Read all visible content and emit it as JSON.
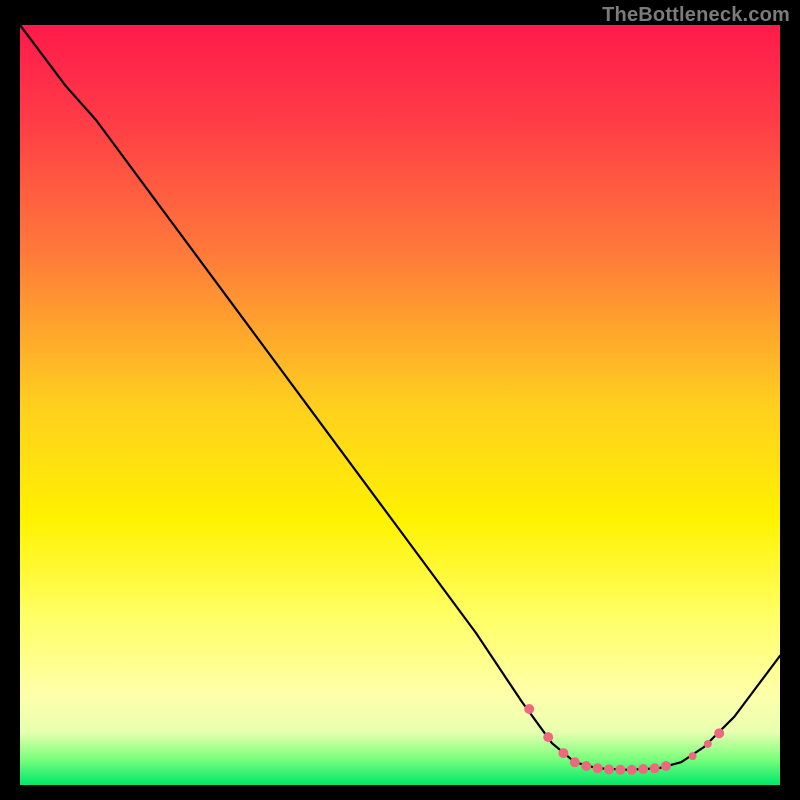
{
  "attribution": "TheBottleneck.com",
  "chart_data": {
    "type": "line",
    "title": "",
    "xlabel": "",
    "ylabel": "",
    "xlim": [
      0,
      100
    ],
    "ylim": [
      0,
      100
    ],
    "grid": false,
    "gradient_stops": [
      {
        "offset": 0.0,
        "color": "#ff1a4b"
      },
      {
        "offset": 0.12,
        "color": "#ff3a47"
      },
      {
        "offset": 0.3,
        "color": "#ff7a3a"
      },
      {
        "offset": 0.5,
        "color": "#ffcf1f"
      },
      {
        "offset": 0.65,
        "color": "#fff200"
      },
      {
        "offset": 0.78,
        "color": "#ffff66"
      },
      {
        "offset": 0.88,
        "color": "#ffffaa"
      },
      {
        "offset": 0.93,
        "color": "#e8ffb0"
      },
      {
        "offset": 0.965,
        "color": "#7dff7d"
      },
      {
        "offset": 1.0,
        "color": "#00e86a"
      }
    ],
    "curve": [
      {
        "x": 0.0,
        "y": 100.0
      },
      {
        "x": 6.0,
        "y": 92.0
      },
      {
        "x": 10.0,
        "y": 87.5
      },
      {
        "x": 20.0,
        "y": 74.0
      },
      {
        "x": 30.0,
        "y": 60.5
      },
      {
        "x": 40.0,
        "y": 47.0
      },
      {
        "x": 50.0,
        "y": 33.5
      },
      {
        "x": 60.0,
        "y": 20.0
      },
      {
        "x": 66.0,
        "y": 11.0
      },
      {
        "x": 70.0,
        "y": 5.5
      },
      {
        "x": 73.0,
        "y": 3.0
      },
      {
        "x": 76.0,
        "y": 2.2
      },
      {
        "x": 80.0,
        "y": 2.0
      },
      {
        "x": 84.0,
        "y": 2.2
      },
      {
        "x": 87.0,
        "y": 3.0
      },
      {
        "x": 90.0,
        "y": 5.0
      },
      {
        "x": 94.0,
        "y": 9.0
      },
      {
        "x": 100.0,
        "y": 17.0
      }
    ],
    "markers": [
      {
        "x": 67.0,
        "y": 10.0,
        "r": 5
      },
      {
        "x": 69.5,
        "y": 6.3,
        "r": 5
      },
      {
        "x": 71.5,
        "y": 4.2,
        "r": 5
      },
      {
        "x": 73.0,
        "y": 3.0,
        "r": 5
      },
      {
        "x": 74.5,
        "y": 2.5,
        "r": 5
      },
      {
        "x": 76.0,
        "y": 2.2,
        "r": 5
      },
      {
        "x": 77.5,
        "y": 2.05,
        "r": 5
      },
      {
        "x": 79.0,
        "y": 2.0,
        "r": 5
      },
      {
        "x": 80.5,
        "y": 2.0,
        "r": 5
      },
      {
        "x": 82.0,
        "y": 2.1,
        "r": 5
      },
      {
        "x": 83.5,
        "y": 2.2,
        "r": 5
      },
      {
        "x": 85.0,
        "y": 2.5,
        "r": 5
      },
      {
        "x": 88.5,
        "y": 3.8,
        "r": 4
      },
      {
        "x": 90.5,
        "y": 5.4,
        "r": 4
      },
      {
        "x": 92.0,
        "y": 6.8,
        "r": 5
      }
    ],
    "marker_color": "#ed6a7e"
  }
}
